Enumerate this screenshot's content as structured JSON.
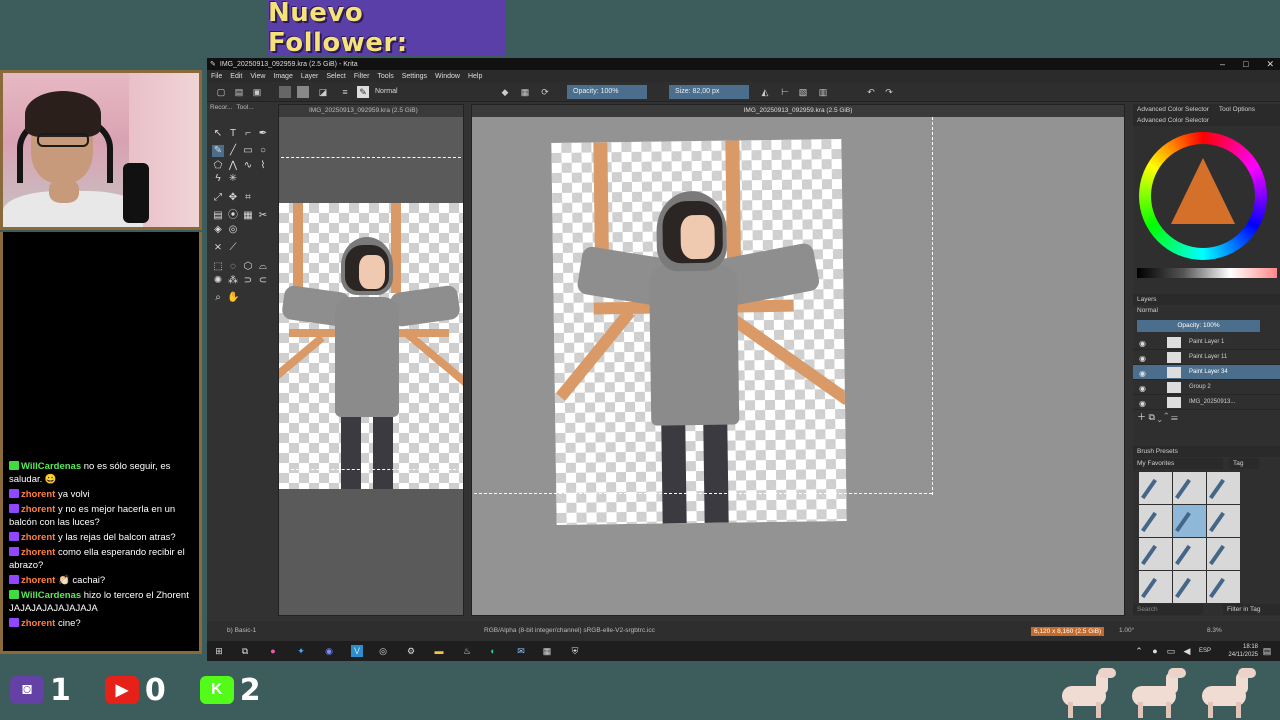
{
  "overlay": {
    "follower_banner": "Nuevo Follower:",
    "chat": [
      {
        "badge": "k",
        "user": "WillCardenas",
        "user_color": "#5ce65c",
        "text": "no es sólo seguir, es saludar. 😀"
      },
      {
        "badge": "t",
        "user": "zhorent",
        "user_color": "#ff7f3f",
        "text": "ya volvi"
      },
      {
        "badge": "t",
        "user": "zhorent",
        "user_color": "#ff7f3f",
        "text": "y no es mejor hacerla en un balcón con las luces?"
      },
      {
        "badge": "t",
        "user": "zhorent",
        "user_color": "#ff7f3f",
        "text": "y las rejas del balcon atras?"
      },
      {
        "badge": "t",
        "user": "zhorent",
        "user_color": "#ff7f3f",
        "text": "como ella esperando recibir el abrazo?"
      },
      {
        "badge": "t",
        "user": "zhorent",
        "user_color": "#ff7f3f",
        "text": "👏🏻 cachai?"
      },
      {
        "badge": "k",
        "user": "WillCardenas",
        "user_color": "#5ce65c",
        "text": "hizo lo tercero el Zhorent JAJAJAJAJAJAJAJA"
      },
      {
        "badge": "t",
        "user": "zhorent",
        "user_color": "#ff7f3f",
        "text": "cine?"
      }
    ],
    "stats": [
      {
        "icon": "twitch-icon",
        "glyph": "◙",
        "color": "#6441a5",
        "value": "1"
      },
      {
        "icon": "youtube-icon",
        "glyph": "▶",
        "color": "#e62117",
        "value": "0"
      },
      {
        "icon": "kick-icon",
        "glyph": "K",
        "color": "#53fc18",
        "value": "2"
      }
    ]
  },
  "krita": {
    "title": "IMG_20250913_092959.kra (2.5 GiB) - Krita",
    "menus": [
      "File",
      "Edit",
      "View",
      "Image",
      "Layer",
      "Select",
      "Filter",
      "Tools",
      "Settings",
      "Window",
      "Help"
    ],
    "toolbar": {
      "blend_mode": "Normal",
      "opacity": "Opacity: 100%",
      "size": "Size: 82,00 px"
    },
    "docker_tabs": [
      "Recor...",
      "Tool..."
    ],
    "left_view_title": "IMG_20250913_092959.kra (2.5 GiB)",
    "center_view_title": "IMG_20250913_092959.kra (2.5 GiB)",
    "right": {
      "tabs": [
        "Advanced Color Selector",
        "Tool Options"
      ],
      "color_selector_title": "Advanced Color Selector",
      "layers_title": "Layers",
      "layers_blend": "Normal",
      "layers_opacity": "Opacity: 100%",
      "layers": [
        {
          "name": "Paint Layer 1",
          "active": false
        },
        {
          "name": "Paint Layer 11",
          "active": false
        },
        {
          "name": "Paint Layer 34",
          "active": true
        },
        {
          "name": "Group 2",
          "active": false
        },
        {
          "name": "IMG_20250913...",
          "active": false
        }
      ],
      "brush_presets_title": "Brush Presets",
      "brush_tag": "My Favorites",
      "brush_tag_label": "Tag",
      "search_placeholder": "Search",
      "filter_label": "Filter in Tag"
    },
    "status": {
      "brush": "b) Basic-1",
      "color_space": "RGB/Alpha (8-bit integer/channel)  sRGB-elle-V2-srgbtrc.icc",
      "image_size": "6,120 x 8,160 (2.5 GiB)",
      "rotation": "1.00°",
      "zoom": "8.3%"
    }
  },
  "taskbar": {
    "time": "18:18",
    "date": "24/11/2025",
    "lang": "ESP"
  }
}
